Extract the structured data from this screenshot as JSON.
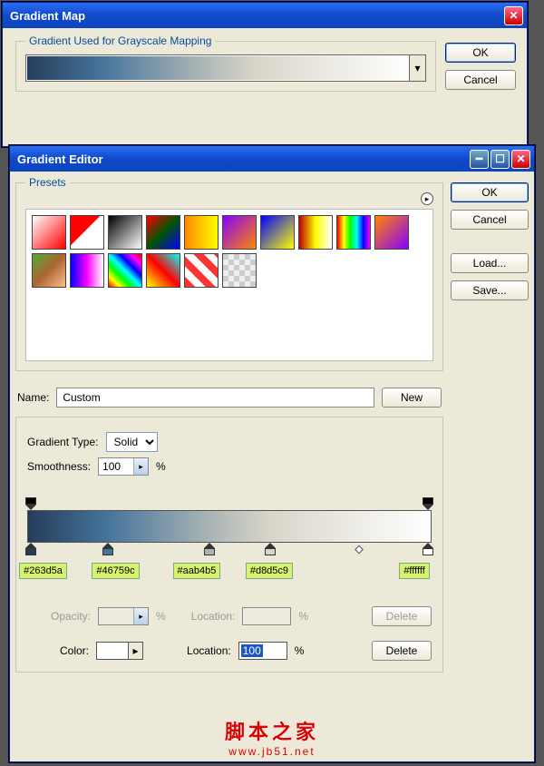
{
  "gm": {
    "title": "Gradient Map",
    "group": "Gradient Used for Grayscale Mapping",
    "ok": "OK",
    "cancel": "Cancel"
  },
  "ge": {
    "title": "Gradient Editor",
    "ok": "OK",
    "cancel": "Cancel",
    "load": "Load...",
    "save": "Save...",
    "presets_label": "Presets",
    "name_label": "Name:",
    "name_value": "Custom",
    "new_btn": "New",
    "gradtype_label": "Gradient Type:",
    "gradtype_value": "Solid",
    "smooth_label": "Smoothness:",
    "smooth_value": "100",
    "pct": "%",
    "opacity_label": "Opacity:",
    "location_label": "Location:",
    "location_value": "100",
    "color_label": "Color:",
    "delete": "Delete",
    "stops": [
      {
        "color": "#263d5a",
        "pos": 0
      },
      {
        "color": "#46759c",
        "pos": 20
      },
      {
        "color": "#aab4b5",
        "pos": 45
      },
      {
        "color": "#d8d5c9",
        "pos": 60
      },
      {
        "color": "#ffffff",
        "pos": 100
      }
    ],
    "stop_labels": [
      "#263d5a",
      "#46759c",
      "#aab4b5",
      "#d8d5c9",
      "#ffffff"
    ]
  },
  "watermark": {
    "cn": "脚本之家",
    "url": "www.jb51.net"
  }
}
